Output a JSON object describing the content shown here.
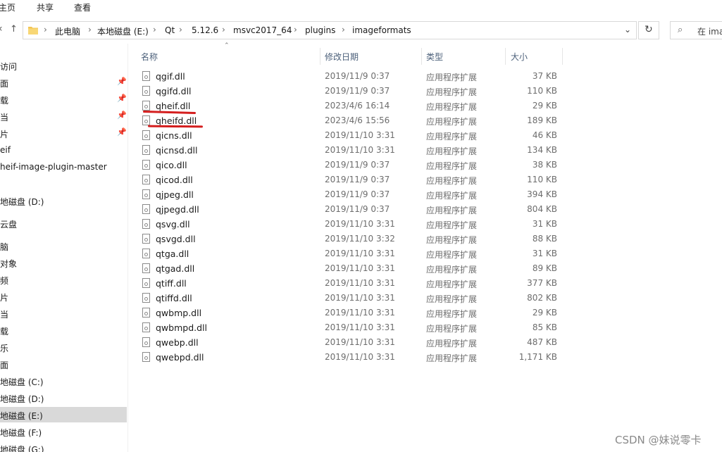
{
  "ribbon": {
    "tabs": [
      "主页",
      "共享",
      "查看"
    ]
  },
  "address": {
    "crumbs": [
      "此电脑",
      "本地磁盘 (E:)",
      "Qt",
      "5.12.6",
      "msvc2017_64",
      "plugins",
      "imageformats"
    ],
    "search_text": "在 ima"
  },
  "nav": [
    {
      "label": "访问",
      "pinned": false
    },
    {
      "label": "面",
      "pinned": true
    },
    {
      "label": "载",
      "pinned": true
    },
    {
      "label": "当",
      "pinned": true
    },
    {
      "label": "片",
      "pinned": true
    },
    {
      "label": "eif",
      "pinned": false
    },
    {
      "label": "heif-image-plugin-master",
      "pinned": false
    },
    {
      "label": "地磁盘 (D:)",
      "pinned": false
    },
    {
      "label": "云盘",
      "pinned": false
    },
    {
      "label": "脑",
      "pinned": false
    },
    {
      "label": "对象",
      "pinned": false
    },
    {
      "label": "频",
      "pinned": false
    },
    {
      "label": "片",
      "pinned": false
    },
    {
      "label": "当",
      "pinned": false
    },
    {
      "label": "载",
      "pinned": false
    },
    {
      "label": "乐",
      "pinned": false
    },
    {
      "label": "面",
      "pinned": false
    },
    {
      "label": "地磁盘 (C:)",
      "pinned": false
    },
    {
      "label": "地磁盘 (D:)",
      "pinned": false
    },
    {
      "label": "地磁盘 (E:)",
      "pinned": false,
      "selected": true
    },
    {
      "label": "地磁盘 (F:)",
      "pinned": false
    },
    {
      "label": "地磁盘 (G:)",
      "pinned": false
    }
  ],
  "columns": {
    "name": "名称",
    "date": "修改日期",
    "type": "类型",
    "size": "大小"
  },
  "files": [
    {
      "name": "qgif.dll",
      "date": "2019/11/9 0:37",
      "type": "应用程序扩展",
      "size": "37 KB"
    },
    {
      "name": "qgifd.dll",
      "date": "2019/11/9 0:37",
      "type": "应用程序扩展",
      "size": "110 KB"
    },
    {
      "name": "qheif.dll",
      "date": "2023/4/6 16:14",
      "type": "应用程序扩展",
      "size": "29 KB"
    },
    {
      "name": "qheifd.dll",
      "date": "2023/4/6 15:56",
      "type": "应用程序扩展",
      "size": "189 KB"
    },
    {
      "name": "qicns.dll",
      "date": "2019/11/10 3:31",
      "type": "应用程序扩展",
      "size": "46 KB"
    },
    {
      "name": "qicnsd.dll",
      "date": "2019/11/10 3:31",
      "type": "应用程序扩展",
      "size": "134 KB"
    },
    {
      "name": "qico.dll",
      "date": "2019/11/9 0:37",
      "type": "应用程序扩展",
      "size": "38 KB"
    },
    {
      "name": "qicod.dll",
      "date": "2019/11/9 0:37",
      "type": "应用程序扩展",
      "size": "110 KB"
    },
    {
      "name": "qjpeg.dll",
      "date": "2019/11/9 0:37",
      "type": "应用程序扩展",
      "size": "394 KB"
    },
    {
      "name": "qjpegd.dll",
      "date": "2019/11/9 0:37",
      "type": "应用程序扩展",
      "size": "804 KB"
    },
    {
      "name": "qsvg.dll",
      "date": "2019/11/10 3:31",
      "type": "应用程序扩展",
      "size": "31 KB"
    },
    {
      "name": "qsvgd.dll",
      "date": "2019/11/10 3:32",
      "type": "应用程序扩展",
      "size": "88 KB"
    },
    {
      "name": "qtga.dll",
      "date": "2019/11/10 3:31",
      "type": "应用程序扩展",
      "size": "31 KB"
    },
    {
      "name": "qtgad.dll",
      "date": "2019/11/10 3:31",
      "type": "应用程序扩展",
      "size": "89 KB"
    },
    {
      "name": "qtiff.dll",
      "date": "2019/11/10 3:31",
      "type": "应用程序扩展",
      "size": "377 KB"
    },
    {
      "name": "qtiffd.dll",
      "date": "2019/11/10 3:31",
      "type": "应用程序扩展",
      "size": "802 KB"
    },
    {
      "name": "qwbmp.dll",
      "date": "2019/11/10 3:31",
      "type": "应用程序扩展",
      "size": "29 KB"
    },
    {
      "name": "qwbmpd.dll",
      "date": "2019/11/10 3:31",
      "type": "应用程序扩展",
      "size": "85 KB"
    },
    {
      "name": "qwebp.dll",
      "date": "2019/11/10 3:31",
      "type": "应用程序扩展",
      "size": "487 KB"
    },
    {
      "name": "qwebpd.dll",
      "date": "2019/11/10 3:31",
      "type": "应用程序扩展",
      "size": "1,171 KB"
    }
  ],
  "watermark": "CSDN @妹说零卡",
  "colors": {
    "accent_underline": "#d41e1e",
    "selected_nav": "#d9d9d9",
    "header_text": "#4c607a"
  }
}
